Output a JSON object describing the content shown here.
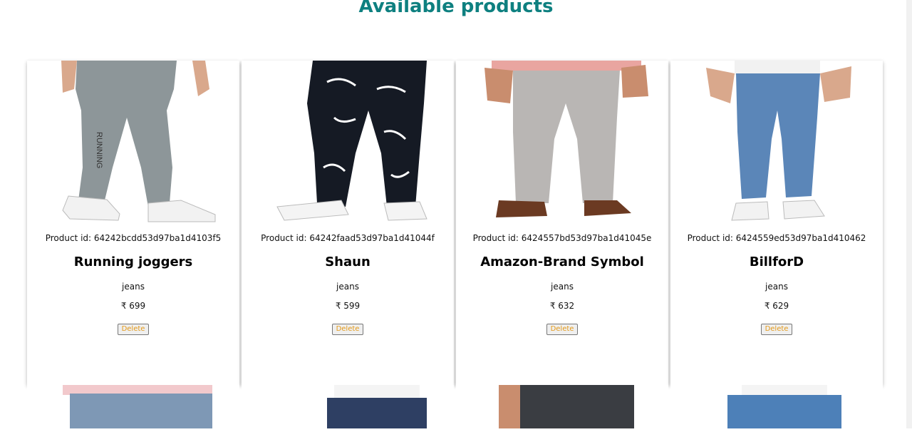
{
  "page": {
    "title": "Available products"
  },
  "products": [
    {
      "id_label": "Product id: 64242bcdd53d97ba1d4103f5",
      "name": "Running joggers",
      "category": "jeans",
      "price": "₹ 699",
      "delete_label": "Delete",
      "color": "#8d9699"
    },
    {
      "id_label": "Product id: 64242faad53d97ba1d41044f",
      "name": "Shaun",
      "category": "jeans",
      "price": "₹ 599",
      "delete_label": "Delete",
      "color": "#151a24"
    },
    {
      "id_label": "Product id: 6424557bd53d97ba1d41045e",
      "name": "Amazon-Brand Symbol",
      "category": "jeans",
      "price": "₹ 632",
      "delete_label": "Delete",
      "color": "#b9b6b4"
    },
    {
      "id_label": "Product id: 6424559ed53d97ba1d410462",
      "name": "BillforD",
      "category": "jeans",
      "price": "₹ 629",
      "delete_label": "Delete",
      "color": "#5b86b8"
    }
  ],
  "second_row": [
    {
      "color": "#7e98b5"
    },
    {
      "color": "#2e3f63"
    },
    {
      "color": "#3a3d42"
    },
    {
      "color": "#4d80b8"
    }
  ]
}
